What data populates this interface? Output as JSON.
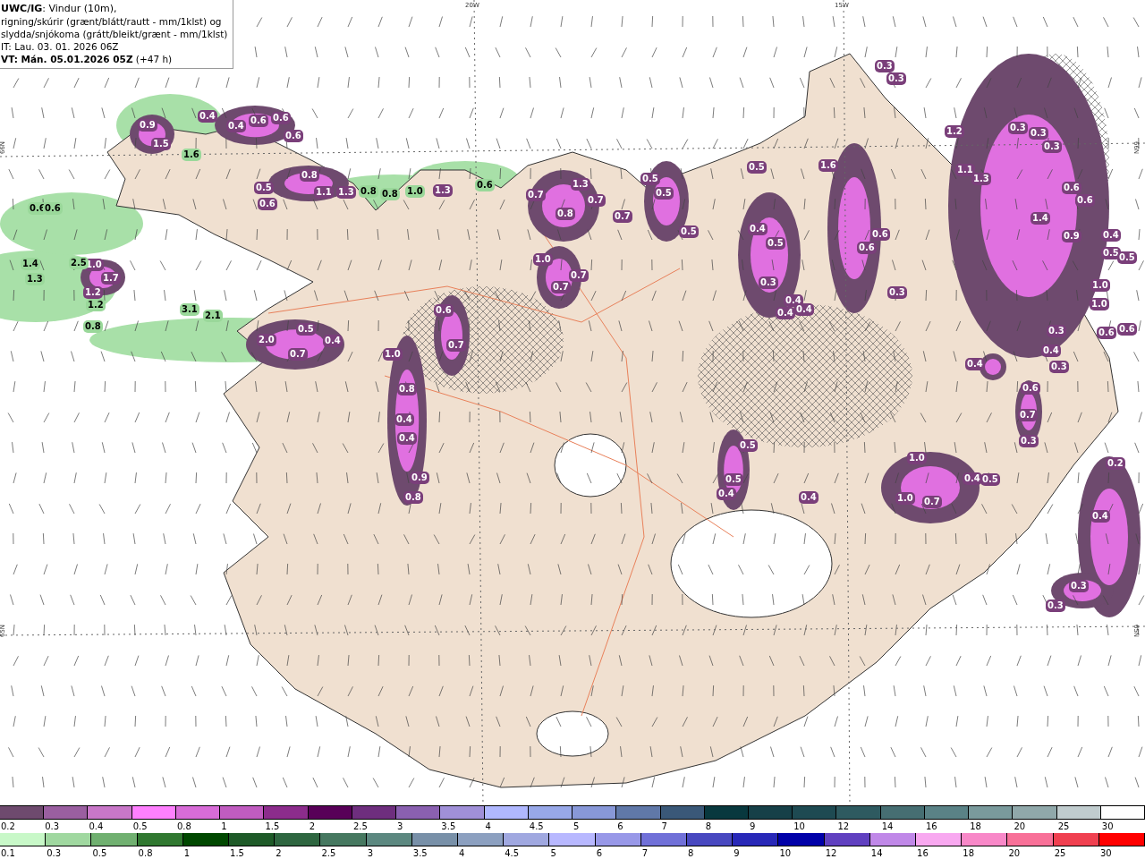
{
  "header": {
    "lines": [
      "**UWC/IG**: Vindur (10m),",
      "rigning/skúrir (grænt/blátt/rautt - mm/1klst) og",
      "slydda/snjókoma (grátt/bleikt/grænt - mm/1klst)",
      "IT: Lau. 03. 01. 2026 06Z",
      "**VT: Mán. 05.01.2026 05Z** (+47 h)"
    ]
  },
  "map": {
    "axis_labels": [
      "20W",
      "15W",
      "66N",
      "66N",
      "65N",
      "65N"
    ],
    "labels": [
      {
        "text": "0.9",
        "kind": "sleet"
      },
      {
        "text": "1.5",
        "kind": "sleet"
      },
      {
        "text": "0.4",
        "kind": "sleet"
      },
      {
        "text": "0.4",
        "kind": "sleet"
      },
      {
        "text": "0.6",
        "kind": "sleet"
      },
      {
        "text": "0.6",
        "kind": "sleet"
      },
      {
        "text": "0.6",
        "kind": "sleet"
      },
      {
        "text": "0.5",
        "kind": "sleet"
      },
      {
        "text": "0.6",
        "kind": "sleet"
      },
      {
        "text": "0.8",
        "kind": "sleet"
      },
      {
        "text": "1.1",
        "kind": "sleet"
      },
      {
        "text": "1.3",
        "kind": "sleet"
      },
      {
        "text": "1.0",
        "kind": "sleet"
      },
      {
        "text": "1.7",
        "kind": "sleet"
      },
      {
        "text": "1.2",
        "kind": "sleet"
      },
      {
        "text": "2.0",
        "kind": "sleet"
      },
      {
        "text": "0.5",
        "kind": "sleet"
      },
      {
        "text": "0.4",
        "kind": "sleet"
      },
      {
        "text": "0.7",
        "kind": "sleet"
      },
      {
        "text": "1.3",
        "kind": "sleet"
      },
      {
        "text": "0.6",
        "kind": "sleet"
      },
      {
        "text": "0.7",
        "kind": "sleet"
      },
      {
        "text": "1.0",
        "kind": "sleet"
      },
      {
        "text": "0.8",
        "kind": "sleet"
      },
      {
        "text": "0.4",
        "kind": "sleet"
      },
      {
        "text": "0.4",
        "kind": "sleet"
      },
      {
        "text": "0.9",
        "kind": "sleet"
      },
      {
        "text": "0.8",
        "kind": "sleet"
      },
      {
        "text": "0.7",
        "kind": "sleet"
      },
      {
        "text": "1.3",
        "kind": "sleet"
      },
      {
        "text": "0.7",
        "kind": "sleet"
      },
      {
        "text": "0.8",
        "kind": "sleet"
      },
      {
        "text": "1.0",
        "kind": "sleet"
      },
      {
        "text": "0.7",
        "kind": "sleet"
      },
      {
        "text": "0.7",
        "kind": "sleet"
      },
      {
        "text": "0.7",
        "kind": "sleet"
      },
      {
        "text": "0.5",
        "kind": "sleet"
      },
      {
        "text": "0.5",
        "kind": "sleet"
      },
      {
        "text": "0.5",
        "kind": "sleet"
      },
      {
        "text": "0.5",
        "kind": "sleet"
      },
      {
        "text": "0.4",
        "kind": "sleet"
      },
      {
        "text": "0.5",
        "kind": "sleet"
      },
      {
        "text": "0.3",
        "kind": "sleet"
      },
      {
        "text": "0.4",
        "kind": "sleet"
      },
      {
        "text": "0.4",
        "kind": "sleet"
      },
      {
        "text": "0.4",
        "kind": "sleet"
      },
      {
        "text": "1.6",
        "kind": "sleet"
      },
      {
        "text": "0.6",
        "kind": "sleet"
      },
      {
        "text": "0.6",
        "kind": "sleet"
      },
      {
        "text": "0.3",
        "kind": "sleet"
      },
      {
        "text": "0.3",
        "kind": "sleet"
      },
      {
        "text": "0.3",
        "kind": "sleet"
      },
      {
        "text": "1.2",
        "kind": "sleet"
      },
      {
        "text": "0.3",
        "kind": "sleet"
      },
      {
        "text": "0.3",
        "kind": "sleet"
      },
      {
        "text": "0.3",
        "kind": "sleet"
      },
      {
        "text": "1.1",
        "kind": "sleet"
      },
      {
        "text": "1.3",
        "kind": "sleet"
      },
      {
        "text": "0.6",
        "kind": "sleet"
      },
      {
        "text": "0.6",
        "kind": "sleet"
      },
      {
        "text": "1.4",
        "kind": "sleet"
      },
      {
        "text": "0.9",
        "kind": "sleet"
      },
      {
        "text": "0.4",
        "kind": "sleet"
      },
      {
        "text": "0.5",
        "kind": "sleet"
      },
      {
        "text": "0.5",
        "kind": "sleet"
      },
      {
        "text": "1.0",
        "kind": "sleet"
      },
      {
        "text": "1.0",
        "kind": "sleet"
      },
      {
        "text": "0.3",
        "kind": "sleet"
      },
      {
        "text": "0.6",
        "kind": "sleet"
      },
      {
        "text": "0.6",
        "kind": "sleet"
      },
      {
        "text": "0.4",
        "kind": "sleet"
      },
      {
        "text": "0.3",
        "kind": "sleet"
      },
      {
        "text": "0.4",
        "kind": "sleet"
      },
      {
        "text": "0.5",
        "kind": "sleet"
      },
      {
        "text": "0.5",
        "kind": "sleet"
      },
      {
        "text": "0.4",
        "kind": "sleet"
      },
      {
        "text": "0.4",
        "kind": "sleet"
      },
      {
        "text": "1.0",
        "kind": "sleet"
      },
      {
        "text": "1.0",
        "kind": "sleet"
      },
      {
        "text": "0.7",
        "kind": "sleet"
      },
      {
        "text": "0.4",
        "kind": "sleet"
      },
      {
        "text": "0.5",
        "kind": "sleet"
      },
      {
        "text": "0.6",
        "kind": "sleet"
      },
      {
        "text": "0.7",
        "kind": "sleet"
      },
      {
        "text": "0.3",
        "kind": "sleet"
      },
      {
        "text": "0.2",
        "kind": "sleet"
      },
      {
        "text": "0.4",
        "kind": "sleet"
      },
      {
        "text": "0.3",
        "kind": "sleet"
      },
      {
        "text": "0.3",
        "kind": "sleet"
      },
      {
        "text": "1.6",
        "kind": "rain"
      },
      {
        "text": "0.6",
        "kind": "rain"
      },
      {
        "text": "0.6",
        "kind": "rain"
      },
      {
        "text": "1.4",
        "kind": "rain"
      },
      {
        "text": "1.3",
        "kind": "rain"
      },
      {
        "text": "2.5",
        "kind": "rain"
      },
      {
        "text": "1.2",
        "kind": "rain"
      },
      {
        "text": "0.8",
        "kind": "rain"
      },
      {
        "text": "3.1",
        "kind": "rain"
      },
      {
        "text": "2.1",
        "kind": "rain"
      },
      {
        "text": "0.8",
        "kind": "rain"
      },
      {
        "text": "0.8",
        "kind": "rain"
      },
      {
        "text": "1.0",
        "kind": "rain"
      },
      {
        "text": "0.6",
        "kind": "rain"
      }
    ]
  },
  "legend": {
    "scales": [
      {
        "cells": [
          {
            "label": "0.2",
            "color": "#6e4a6e"
          },
          {
            "label": "0.3",
            "color": "#9a5fa0"
          },
          {
            "label": "0.4",
            "color": "#c877c8"
          },
          {
            "label": "0.5",
            "color": "#ff80ff"
          },
          {
            "label": "0.8",
            "color": "#d86cd8"
          },
          {
            "label": "1",
            "color": "#c05cc0"
          },
          {
            "label": "1.5",
            "color": "#8c2c8c"
          },
          {
            "label": "2",
            "color": "#580058"
          },
          {
            "label": "2.5",
            "color": "#6e2e7e"
          },
          {
            "label": "3",
            "color": "#8a60b0"
          },
          {
            "label": "3.5",
            "color": "#a090d8"
          },
          {
            "label": "4",
            "color": "#b0b8ff"
          },
          {
            "label": "4.5",
            "color": "#98a8e8"
          },
          {
            "label": "5",
            "color": "#8898d8"
          },
          {
            "label": "6",
            "color": "#6078a8"
          },
          {
            "label": "7",
            "color": "#3a5878"
          },
          {
            "label": "8",
            "color": "#08383e"
          },
          {
            "label": "9",
            "color": "#164048"
          },
          {
            "label": "10",
            "color": "#1e4a52"
          },
          {
            "label": "12",
            "color": "#2e5a60"
          },
          {
            "label": "14",
            "color": "#466e72"
          },
          {
            "label": "16",
            "color": "#5a8286"
          },
          {
            "label": "18",
            "color": "#7a9a9c"
          },
          {
            "label": "20",
            "color": "#90a8aa"
          },
          {
            "label": "25",
            "color": "#c0ccce"
          },
          {
            "label": "30",
            "color": "#ffffff"
          }
        ]
      },
      {
        "cells": [
          {
            "label": "0.1",
            "color": "#c8f8c8"
          },
          {
            "label": "0.3",
            "color": "#a0d8a0"
          },
          {
            "label": "0.5",
            "color": "#70b070"
          },
          {
            "label": "0.8",
            "color": "#307830"
          },
          {
            "label": "1",
            "color": "#004800"
          },
          {
            "label": "1.5",
            "color": "#1e5a28"
          },
          {
            "label": "2",
            "color": "#2e6640"
          },
          {
            "label": "2.5",
            "color": "#467860"
          },
          {
            "label": "3",
            "color": "#5c8880"
          },
          {
            "label": "3.5",
            "color": "#7890a8"
          },
          {
            "label": "4",
            "color": "#8ca0c0"
          },
          {
            "label": "4.5",
            "color": "#a0a8e0"
          },
          {
            "label": "5",
            "color": "#b8b8ff"
          },
          {
            "label": "6",
            "color": "#9898e8"
          },
          {
            "label": "7",
            "color": "#7070d8"
          },
          {
            "label": "8",
            "color": "#4848c0"
          },
          {
            "label": "9",
            "color": "#2828b8"
          },
          {
            "label": "10",
            "color": "#0000a8"
          },
          {
            "label": "12",
            "color": "#6040c0"
          },
          {
            "label": "14",
            "color": "#c088e8"
          },
          {
            "label": "16",
            "color": "#f8a8f0"
          },
          {
            "label": "18",
            "color": "#f888c8"
          },
          {
            "label": "20",
            "color": "#f87098"
          },
          {
            "label": "25",
            "color": "#f04050"
          },
          {
            "label": "30",
            "color": "#ff0000"
          }
        ]
      }
    ]
  }
}
